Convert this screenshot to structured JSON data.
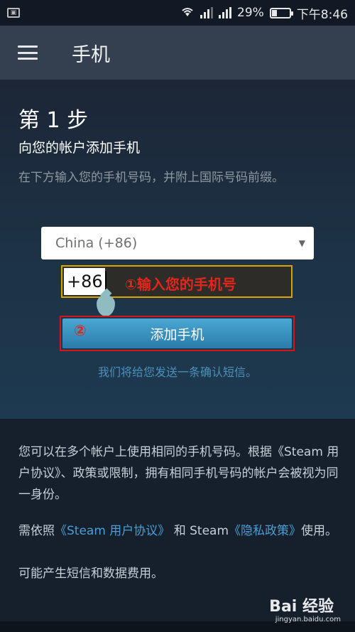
{
  "status_bar": {
    "battery": "29%",
    "battery_level": 0.29,
    "time": "下午8:46"
  },
  "app_bar": {
    "title": "手机"
  },
  "step": {
    "title": "第 1 步",
    "subtitle": "向您的帐户添加手机",
    "description": "在下方输入您的手机号码，并附上国际号码前缀。"
  },
  "form": {
    "country_value": "China (+86)",
    "phone_value": "+86",
    "phone_annotation": "①输入您的手机号",
    "add_button_label": "添加手机",
    "add_annotation": "②",
    "confirm_note": "我们将给您发送一条确认短信。"
  },
  "info": {
    "paragraph": "您可以在多个帐户上使用相同的手机号码。根据《Steam 用户协议》、政策或限制，拥有相同手机号码的帐户会被视为同一身份。",
    "terms_prefix": "需依照",
    "terms_link1": "《Steam 用户协议》",
    "terms_mid": "和 Steam",
    "terms_link2": "《隐私政策》",
    "terms_suffix": "使用。",
    "fees": "可能产生短信和数据费用。"
  },
  "watermark": {
    "text": "Bai 经验",
    "url": "jingyan.baidu.com"
  }
}
